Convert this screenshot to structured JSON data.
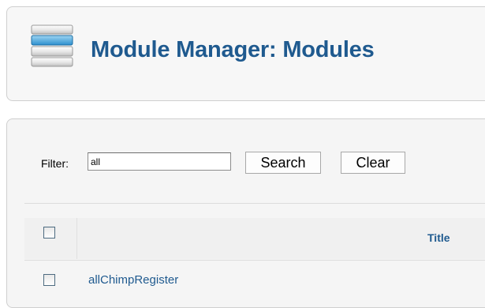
{
  "header": {
    "title": "Module Manager: Modules",
    "icon": "module-manager-icon"
  },
  "filter": {
    "label": "Filter:",
    "value": "all",
    "search_label": "Search",
    "clear_label": "Clear"
  },
  "table": {
    "columns": [
      "Title"
    ],
    "rows": [
      {
        "title": "allChimpRegister"
      }
    ]
  },
  "colors": {
    "title_blue": "#1f5a8f",
    "panel_bg": "#f7f7f7",
    "border": "#cfcfcf"
  }
}
